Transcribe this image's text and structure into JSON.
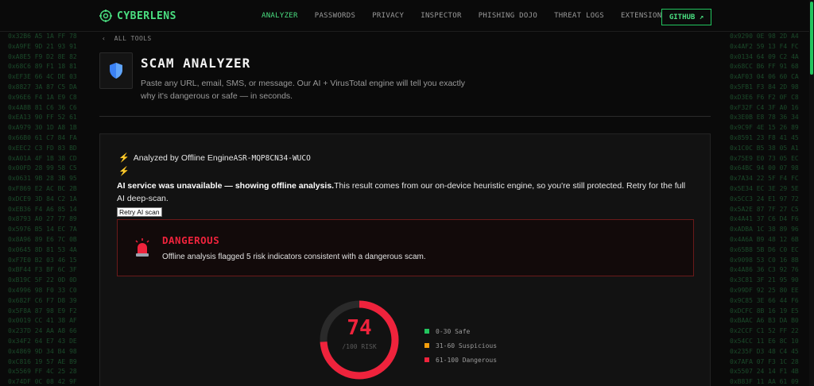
{
  "colors": {
    "accent": "#4ade80",
    "danger": "#ef233c",
    "warn": "#f59e0b",
    "safe": "#22c55e",
    "bolt": "#fb923c"
  },
  "nav": {
    "brand": "CYBERLENS",
    "links": [
      "ANALYZER",
      "PASSWORDS",
      "PRIVACY",
      "INSPECTOR",
      "PHISHING DOJO",
      "THREAT LOGS",
      "EXTENSION"
    ],
    "active": "ANALYZER",
    "github_label": "GITHUB ↗"
  },
  "hex": {
    "left": [
      "0x32B6 A5 1A FF 78",
      "0xA9FE 9D 21 93 91",
      "0xA8E5 F9 D2 8E 82",
      "0x68C6 89 F1 18 81",
      "0xEF3E 66 4C DE 03",
      "0x8827 3A 87 C5 DA",
      "0x96E6 F4 1A E9 C8",
      "0x4A8B 81 C6 36 C6",
      "0xEA13 90 FF 52 61",
      "0xA979 30 1D A8 1B",
      "0x66B0 61 C7 84 FA",
      "0xEEC2 C3 FD 83 BD",
      "0xA01A 4F 1B 38 CD",
      "0x00FD 28 99 58 C5",
      "0x0631 9B 28 3B 95",
      "0xF869 E2 AC BC 2B",
      "0xDCE9 3D 84 C2 1A",
      "0xEB36 F4 A6 85 14",
      "0x8793 A0 27 77 89",
      "0x5976 B5 14 EC 7A",
      "0x8A96 89 E6 7C 0B",
      "0x0645 8D 81 53 4A",
      "0xF7E0 B2 03 46 15",
      "0xBF44 F3 BF 6C 3F",
      "0xB19C 5F 22 0D 0D",
      "0x4996 98 F0 33 C0",
      "0x682F C6 F7 D8 39",
      "0x5F8A 87 98 E9 F2",
      "0x0019 CC 41 38 AF",
      "0x237D 24 AA A8 66",
      "0x34F2 64 E7 43 DE",
      "0x4869 9D 34 B4 98",
      "0xC816 19 57 AE B9",
      "0x5569 FF 4C 25 28",
      "0x74DF 0C 08 42 9F"
    ],
    "right": [
      "0x9290 0E 98 2D A4",
      "0x4AF2 59 13 F4 FC",
      "0x0134 64 09 C2 4A",
      "0x68CC B6 FF 91 68",
      "0xAF03 04 06 60 CA",
      "0x5FB1 F3 84 2D 98",
      "0xD3E6 F6 F2 0F C8",
      "0xF32F C4 3F A0 16",
      "0x3E0B E8 78 36 34",
      "0x9C9F 4E 15 26 89",
      "0x8591 23 F8 41 45",
      "0x1C0C B5 38 05 A1",
      "0x75E9 E0 73 05 EC",
      "0x64BC 94 00 07 98",
      "0x7A34 22 5F F4 FC",
      "0x5E34 EC 3E 29 5E",
      "0x5CC3 24 E1 97 72",
      "0x5A2E 87 7F 27 C5",
      "0x4A41 37 C6 D4 F6",
      "0xADBA 1C 38 89 96",
      "0x4A6A B9 48 12 6B",
      "0x65B8 5B D6 C0 EC",
      "0x9098 53 C0 16 8B",
      "0x4A86 36 C3 92 76",
      "0x3C81 3F 21 95 90",
      "0x99DF 92 25 80 EE",
      "0x9C85 3E 66 44 F6",
      "0xDCFC 8B 16 19 E5",
      "0xBAAC A6 B3 DA B0",
      "0x2CCF C1 52 FF 22",
      "0x54CC 11 E6 8C 10",
      "0x235F D3 48 C4 45",
      "0x7AFA 07 F3 1C 28",
      "0x5507 24 14 F1 4B",
      "0xB83F 11 AA 61 09"
    ]
  },
  "header": {
    "back_label": "ALL TOOLS",
    "title": "SCAM ANALYZER",
    "description": "Paste any URL, email, SMS, or message. Our AI + VirusTotal engine will tell you exactly why it's dangerous or safe — in seconds.",
    "shield_icon": "shield-icon"
  },
  "result": {
    "analyzed_prefix": "Analyzed by Offline Engine",
    "analysis_id": "ASR-MQP8CN34-WUCO",
    "notice_bold": "AI service was unavailable — showing offline analysis.",
    "notice_rest": "This result comes from our on-device heuristic engine, so you're still protected. Retry for the full AI deep-scan.",
    "retry_label": "Retry AI scan",
    "verdict": "DANGEROUS",
    "verdict_desc": "Offline analysis flagged 5 risk indicators consistent with a dangerous scam.",
    "score": "74",
    "score_max": "/100 RISK",
    "score_fraction": 0.74,
    "legend": [
      {
        "label": "0-30 Safe",
        "color": "#22c55e"
      },
      {
        "label": "31-60 Suspicious",
        "color": "#f59e0b"
      },
      {
        "label": "61-100 Dangerous",
        "color": "#ef233c"
      }
    ]
  }
}
